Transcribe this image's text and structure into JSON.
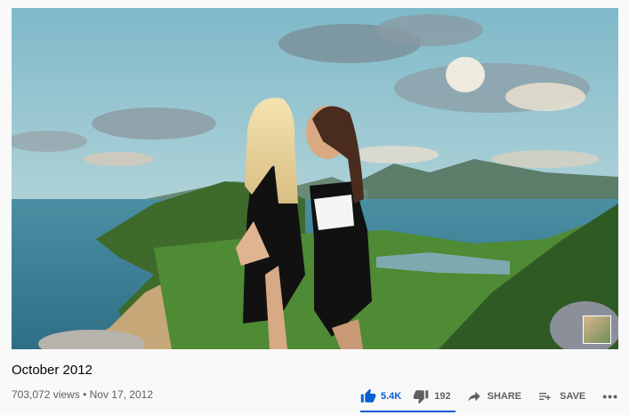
{
  "video": {
    "title": "October 2012",
    "views": "703,072 views",
    "separator": "•",
    "date": "Nov 17, 2012"
  },
  "actions": {
    "like_count": "5.4K",
    "dislike_count": "192",
    "share_label": "SHARE",
    "save_label": "SAVE",
    "more_label": "•••"
  },
  "icons": {
    "like": "thumbs-up-icon",
    "dislike": "thumbs-down-icon",
    "share": "share-arrow-icon",
    "save": "playlist-add-icon",
    "more": "more-horizontal-icon"
  },
  "colors": {
    "accent": "#065fd4",
    "secondary_text": "#606060",
    "primary_text": "#030303",
    "background": "#f9f9f9"
  }
}
